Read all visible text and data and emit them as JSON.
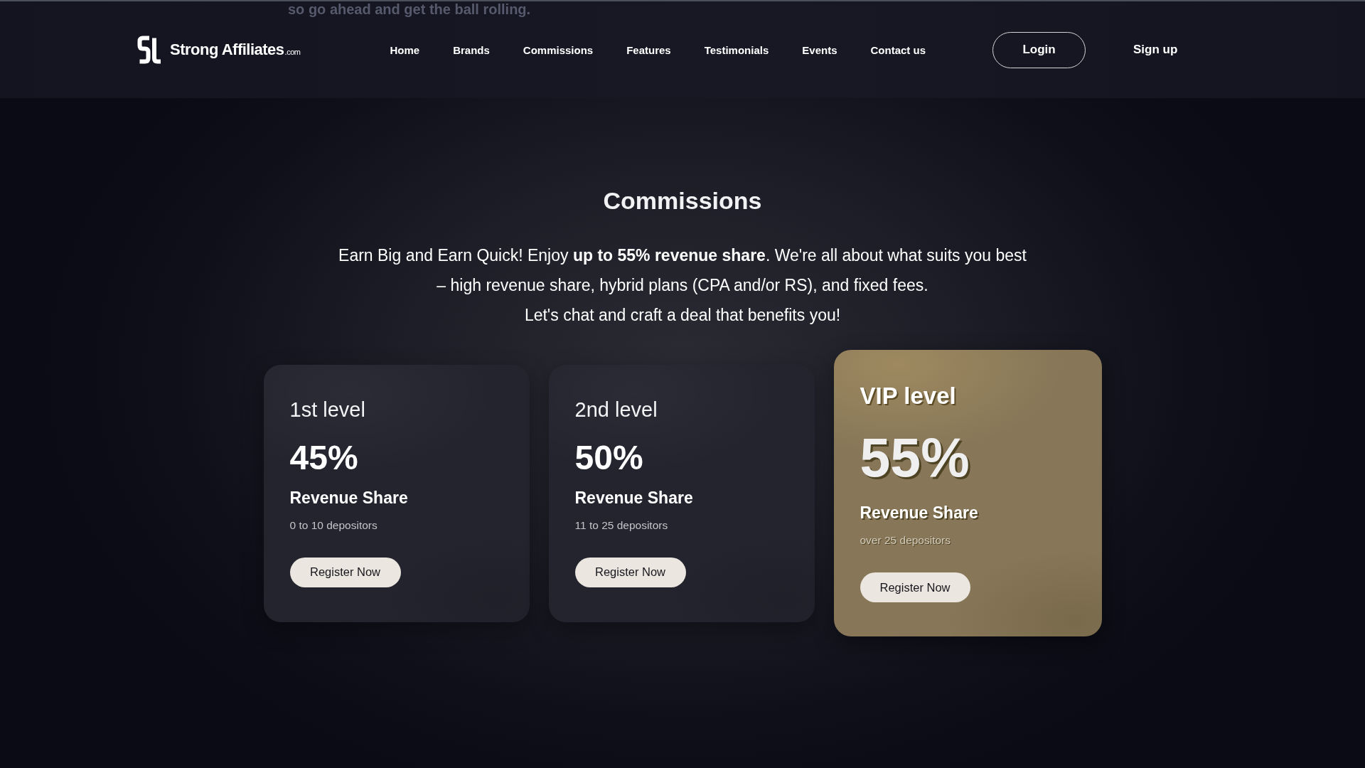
{
  "background_text": "so go ahead and get the ball rolling.",
  "header": {
    "logo": {
      "name": "Strong Affiliates",
      "suffix": ".com"
    },
    "nav": [
      "Home",
      "Brands",
      "Commissions",
      "Features",
      "Testimonials",
      "Events",
      "Contact us"
    ],
    "login": "Login",
    "signup": "Sign up"
  },
  "section": {
    "title": "Commissions",
    "description_lines": [
      "Earn Big and Earn Quick! Enjoy **up to 55% revenue share**. We're all about what suits you best",
      "– high revenue share, hybrid plans (CPA and/or RS), and fixed fees.",
      "Let's chat and craft a deal that benefits you!"
    ],
    "tiers": [
      {
        "kind": "standard",
        "name": "1st level",
        "percent": "45%",
        "label": "Revenue Share",
        "depositors": "0 to 10 depositors",
        "button": "Register Now"
      },
      {
        "kind": "standard",
        "name": "2nd level",
        "percent": "50%",
        "label": "Revenue Share",
        "depositors": "11 to 25 depositors",
        "button": "Register Now"
      },
      {
        "kind": "vip",
        "name": "VIP level",
        "percent": "55%",
        "label": "Revenue Share",
        "depositors": "over 25 depositors",
        "button": "Register Now"
      }
    ]
  }
}
